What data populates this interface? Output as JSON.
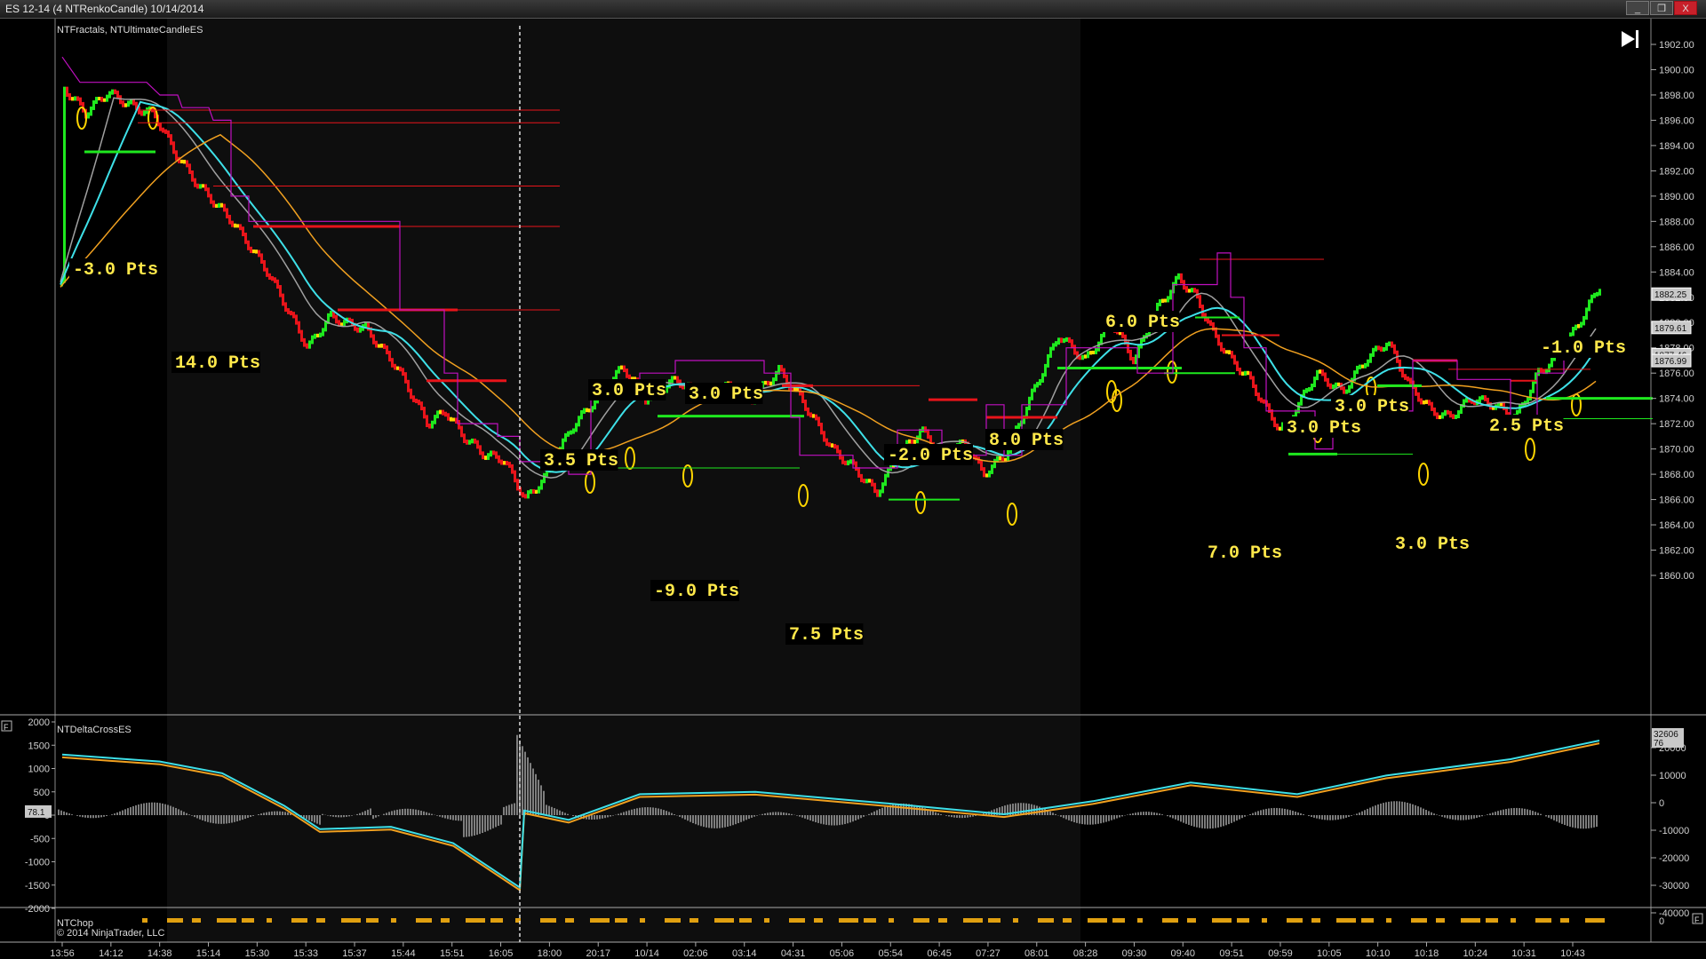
{
  "window": {
    "title": "ES 12-14 (4 NTRenkoCandle)  10/14/2014",
    "buttons": {
      "close": "X",
      "minimize": "_",
      "restore": "❒"
    }
  },
  "chart": {
    "indicator_label": "NTFractals, NTUltimateCandleES",
    "skip_end_icon": "skip-to-end-icon",
    "price_axis": [
      "1902.00",
      "1900.00",
      "1898.00",
      "1896.00",
      "1894.00",
      "1892.00",
      "1890.00",
      "1888.00",
      "1886.00",
      "1884.00",
      "1882.00",
      "1880.00",
      "1878.00",
      "1876.00",
      "1874.00",
      "1872.00",
      "1870.00",
      "1868.00",
      "1866.00",
      "1864.00",
      "1862.00",
      "1860.00"
    ],
    "price_markers": [
      {
        "label": "1882.25",
        "price": 1882.25
      },
      {
        "label": "1879.61",
        "price": 1879.61
      },
      {
        "label": "1877.46",
        "price": 1877.46
      },
      {
        "label": "1876.99",
        "price": 1876.99
      }
    ],
    "time_axis": [
      "13:56",
      "14:12",
      "14:38",
      "15:14",
      "15:30",
      "15:33",
      "15:37",
      "15:44",
      "15:51",
      "16:05",
      "18:00",
      "20:17",
      "10/14",
      "02:06",
      "03:14",
      "04:31",
      "05:06",
      "05:54",
      "06:45",
      "07:27",
      "08:01",
      "08:28",
      "09:30",
      "09:40",
      "09:51",
      "09:59",
      "10:05",
      "10:10",
      "10:18",
      "10:24",
      "10:31",
      "10:43"
    ],
    "trade_labels": [
      "-3.0 Pts",
      "14.0 Pts",
      "3.0 Pts",
      "3.0 Pts",
      "3.5 Pts",
      "-9.0 Pts",
      "7.5 Pts",
      "-2.0 Pts",
      "8.0 Pts",
      "6.0 Pts",
      "7.0 Pts",
      "3.0 Pts",
      "3.0 Pts",
      "3.0 Pts",
      "2.5 Pts",
      "-1.0 Pts"
    ]
  },
  "delta_panel": {
    "title": "NTDeltaCrossES",
    "panel_icon": "F",
    "left_axis": [
      "2000",
      "1500",
      "1000",
      "500",
      "0",
      "-500",
      "-1000",
      "-1500",
      "-2000"
    ],
    "left_marker": "78.1",
    "right_axis": [
      "20000",
      "10000",
      "0",
      "-10000",
      "-20000",
      "-30000",
      "-40000"
    ],
    "right_markers": [
      "32606",
      "76"
    ]
  },
  "strip_panel": {
    "title": "NTChop",
    "copyright": "© 2014 NinjaTrader, LLC",
    "right_axis": "0",
    "panel_icon": "F"
  },
  "colors": {
    "background": "#000000",
    "session_shade": "#0f0f0f",
    "bear": "#e8141a",
    "bull": "#1ee81e",
    "neutral": "#ffd500",
    "cyan_ma": "#3ee0e8",
    "orange_ma": "#f0a020",
    "gray_ma": "#a0a0a0",
    "stop_line": "#c010c0",
    "label": "#ffe84a"
  }
}
